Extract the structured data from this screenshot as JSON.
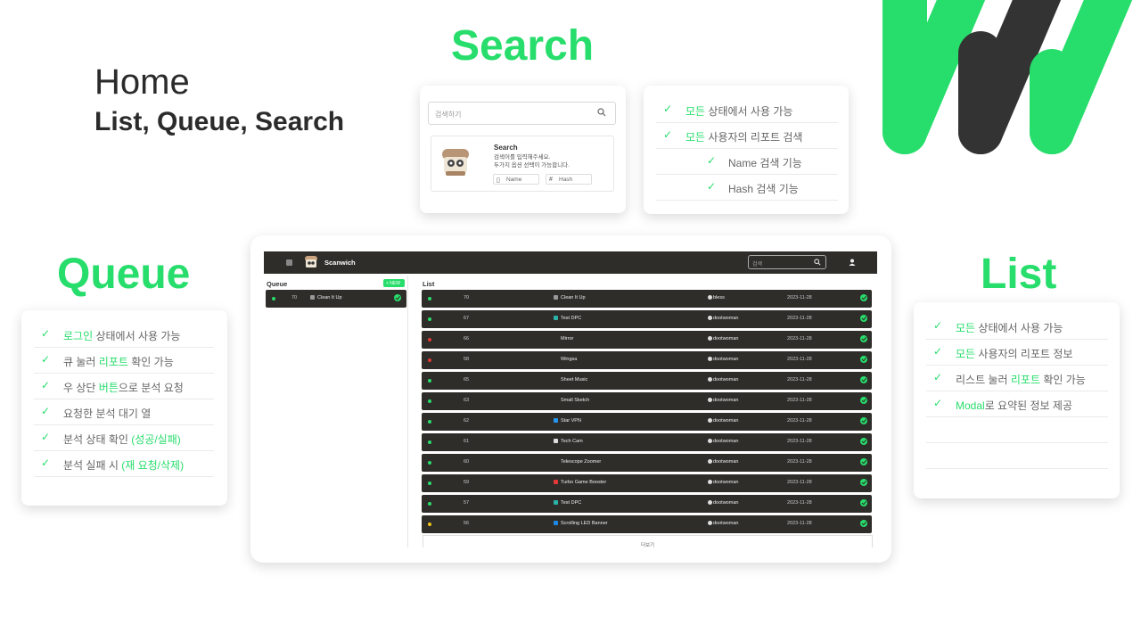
{
  "home": {
    "title": "Home",
    "subtitle": "List, Queue, Search"
  },
  "sections": {
    "search": "Search",
    "queue": "Queue",
    "list": "List"
  },
  "colors": {
    "accent": "#27dd6b",
    "dark": "#2f2d2a",
    "dot_green": "#27dd6b",
    "dot_red": "#e53935",
    "dot_yellow": "#f5c518"
  },
  "search_mock": {
    "placeholder": "검색하기",
    "title": "Search",
    "desc_line1": "검색어를 입력해주세요.",
    "desc_line2": "두가지 옵션 선택이 가능합니다.",
    "option_name": "Name",
    "option_hash": "Hash"
  },
  "search_features": [
    {
      "hl": "모든",
      "rest": " 상태에서 사용 가능"
    },
    {
      "hl": "모든",
      "rest": " 사용자의 리포트 검색"
    },
    {
      "hl": "",
      "rest": "Name 검색 기능"
    },
    {
      "hl": "",
      "rest": "Hash 검색 기능"
    }
  ],
  "queue_features": [
    {
      "pre": "",
      "hl": "로그인",
      "rest": " 상태에서 사용 가능"
    },
    {
      "pre": "큐 눌러 ",
      "hl": "리포트",
      "rest": " 확인 가능"
    },
    {
      "pre": "우 상단 ",
      "hl": "버튼",
      "rest": "으로 분석 요청"
    },
    {
      "pre": "요청한 분석 대기 열",
      "hl": "",
      "rest": ""
    },
    {
      "pre": "분석  상태 확인 ",
      "hl": "(성공/실패)",
      "rest": ""
    },
    {
      "pre": "분석 실패 시 ",
      "hl": "(재 요청/삭제)",
      "rest": ""
    }
  ],
  "list_features": [
    {
      "pre": "",
      "hl": "모든",
      "rest": " 상태에서 사용 가능"
    },
    {
      "pre": "",
      "hl": "모든",
      "rest": " 사용자의 리포트 정보"
    },
    {
      "pre": "리스트 눌러 ",
      "hl": "리포트",
      "rest": " 확인 가능"
    },
    {
      "pre": "",
      "hl": "Modal",
      "rest": "로 요약된 정보 제공"
    }
  ],
  "app": {
    "brand": "Scanwich",
    "search_placeholder": "검색",
    "queue_title": "Queue",
    "new_label": "+ NEW",
    "list_title": "List",
    "more_label": "더보기",
    "queue_items": [
      {
        "id": "70",
        "name": "Clean It Up",
        "status": "green"
      }
    ],
    "list_items": [
      {
        "id": "70",
        "name": "Clean It Up",
        "user": "bless",
        "date": "2023-11-28",
        "status": "green",
        "icon": "#999999"
      },
      {
        "id": "67",
        "name": "Test DPC",
        "user": "dootwoman",
        "date": "2023-11-28",
        "status": "green",
        "icon": "#2ab3a6"
      },
      {
        "id": "66",
        "name": "Mirror",
        "user": "dootwoman",
        "date": "2023-11-28",
        "status": "red",
        "icon": ""
      },
      {
        "id": "58",
        "name": "Wingsa",
        "user": "dootwoman",
        "date": "2023-11-28",
        "status": "red",
        "icon": ""
      },
      {
        "id": "65",
        "name": "Sheet Music",
        "user": "dootwoman",
        "date": "2023-11-28",
        "status": "green",
        "icon": ""
      },
      {
        "id": "63",
        "name": "Small Sketch",
        "user": "dootwoman",
        "date": "2023-11-28",
        "status": "green",
        "icon": ""
      },
      {
        "id": "62",
        "name": "Star VPN",
        "user": "dootwoman",
        "date": "2023-11-28",
        "status": "green",
        "icon": "#2196f3"
      },
      {
        "id": "61",
        "name": "Tech Cam",
        "user": "dootwoman",
        "date": "2023-11-28",
        "status": "green",
        "icon": "#dddddd"
      },
      {
        "id": "60",
        "name": "Telescope Zoomer",
        "user": "dootwoman",
        "date": "2023-11-28",
        "status": "green",
        "icon": ""
      },
      {
        "id": "59",
        "name": "Turbo Game Booster",
        "user": "dootwoman",
        "date": "2023-11-28",
        "status": "green",
        "icon": "#e53935"
      },
      {
        "id": "57",
        "name": "Test DPC",
        "user": "dootwoman",
        "date": "2023-11-28",
        "status": "green",
        "icon": "#2ab3a6"
      },
      {
        "id": "56",
        "name": "Scrolling LED Banner",
        "user": "dootwoman",
        "date": "2023-11-28",
        "status": "yellow",
        "icon": "#1e88e5"
      }
    ]
  }
}
